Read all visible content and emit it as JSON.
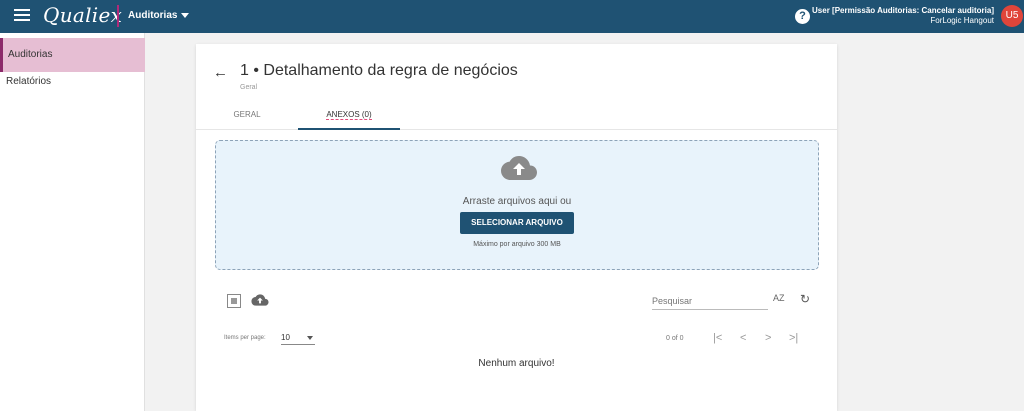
{
  "app": {
    "logo": "Qualiex",
    "module": "Auditorias",
    "help_icon": "?",
    "user_name": "User [Permissão Auditorias: Cancelar auditoria]",
    "user_org": "ForLogic Hangout",
    "avatar": "U5"
  },
  "sidebar": {
    "items": [
      {
        "label": "Auditorias",
        "active": true
      },
      {
        "label": "Relatórios",
        "active": false
      }
    ]
  },
  "page": {
    "back_icon": "←",
    "title": "1 • Detalhamento da regra de negócios",
    "subtitle": "Geral"
  },
  "tabs": [
    {
      "label": "GERAL"
    },
    {
      "label": "ANEXOS (0)"
    }
  ],
  "dropzone": {
    "icon": "cloud-upload-icon",
    "text": "Arraste arquivos aqui ou",
    "button": "SELECIONAR ARQUIVO",
    "max": "Máximo por arquivo 300 MB"
  },
  "toolbar": {
    "search_placeholder": "Pesquisar",
    "sort_icon": "AZ",
    "refresh_icon": "↻"
  },
  "pagination": {
    "items_per_page_label": "Items per page:",
    "items_per_page": "10",
    "range": "0 of 0",
    "first": "|<",
    "prev": "<",
    "next": ">",
    "last": ">|"
  },
  "empty_message": "Nenhum arquivo!",
  "colors": {
    "header": "#1f5273",
    "sidebar_active": "#e6bed3",
    "dropzone_bg": "#e8f3fb",
    "button": "#1f5273",
    "avatar": "#e0453a"
  }
}
